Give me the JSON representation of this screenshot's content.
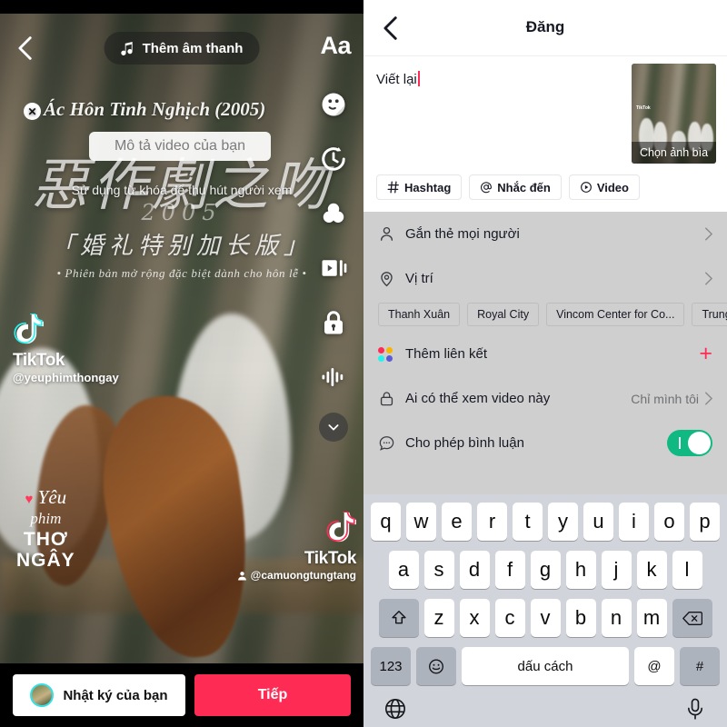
{
  "left_editor": {
    "back_icon": "chevron-left-icon",
    "sound_button": {
      "label": "Thêm âm thanh",
      "icon": "music-note-icon"
    },
    "text_button_label": "Aa",
    "video_title_overlay": "Ác Hôn Tinh Nghịch (2005)",
    "description_placeholder": "Mô tả video của bạn",
    "keyword_hint": "Sử dụng từ khóa để thu hút người xem",
    "cjk_title": "惡作劇之吻",
    "cjk_year": "2005",
    "cjk_subtitle": "「婚礼特别加长版」",
    "cjk_subtitle2": "• Phiên bản mở rộng đặc biệt dành cho hôn lễ •",
    "rail_items": [
      {
        "name": "stickers-icon",
        "label": "Sticker"
      },
      {
        "name": "timer-icon",
        "label": "Hẹn giờ"
      },
      {
        "name": "filters-icon",
        "label": "Bộ lọc"
      },
      {
        "name": "adjust-clips-icon",
        "label": "Điều chỉnh đoạn"
      },
      {
        "name": "privacy-lock-icon",
        "label": "Quyền riêng tư"
      },
      {
        "name": "voice-effects-icon",
        "label": "Hiệu ứng giọng nói"
      },
      {
        "name": "chevron-down-icon",
        "label": "Thu gọn"
      }
    ],
    "watermark_left": {
      "brand": "TikTok",
      "handle": "@yeuphimthongay"
    },
    "watermark_right": {
      "brand": "TikTok",
      "handle": "@camuongtungtang"
    },
    "stamp": {
      "line1": "Yêu",
      "line2": "phim",
      "line3": "THƠ",
      "line4": "NGÂY"
    },
    "diary_button_label": "Nhật ký của bạn",
    "next_button_label": "Tiếp",
    "accent_color": "#fe2c55"
  },
  "post_form": {
    "header": {
      "title": "Đăng",
      "back_icon": "chevron-left-icon"
    },
    "caption_value": "Viết lại",
    "cover": {
      "label": "Chọn ảnh bìa",
      "watermark": "TikTok"
    },
    "quick_chips": [
      {
        "icon": "hashtag-icon",
        "label": "Hashtag"
      },
      {
        "icon": "at-mention-icon",
        "label": "Nhắc đến"
      },
      {
        "icon": "video-circle-icon",
        "label": "Video"
      }
    ],
    "rows": [
      {
        "icon": "person-icon",
        "label": "Gắn thẻ mọi người",
        "value": "",
        "control": "chevron"
      },
      {
        "icon": "location-pin-icon",
        "label": "Vị trí",
        "value": "",
        "control": "chevron"
      },
      {
        "icon": "link-dots-icon",
        "label": "Thêm liên kết",
        "value": "",
        "control": "plus"
      },
      {
        "icon": "lock-icon",
        "label": "Ai có thể xem video này",
        "value": "Chỉ mình tôi",
        "control": "chevron"
      },
      {
        "icon": "comment-icon",
        "label": "Cho phép bình luận",
        "value": "",
        "control": "toggle-on"
      }
    ],
    "location_chips": [
      "Thanh Xuân",
      "Royal City",
      "Vincom Center for Co...",
      "Trung tâm nghệ"
    ],
    "toggle_on_color": "#10b981",
    "panel_bg": "#cfcfcf"
  },
  "keyboard": {
    "row1": [
      "q",
      "w",
      "e",
      "r",
      "t",
      "y",
      "u",
      "i",
      "o",
      "p"
    ],
    "row2": [
      "a",
      "s",
      "d",
      "f",
      "g",
      "h",
      "j",
      "k",
      "l"
    ],
    "row3": [
      "z",
      "x",
      "c",
      "v",
      "b",
      "n",
      "m"
    ],
    "shift_icon": "shift-up-arrow-icon",
    "backspace_icon": "backspace-delete-icon",
    "numbers_key": "123",
    "emoji_icon": "emoji-smiley-icon",
    "space_key": "dấu cách",
    "at_key": "@",
    "hash_key": "#",
    "globe_icon": "globe-language-icon",
    "mic_icon": "microphone-icon"
  }
}
